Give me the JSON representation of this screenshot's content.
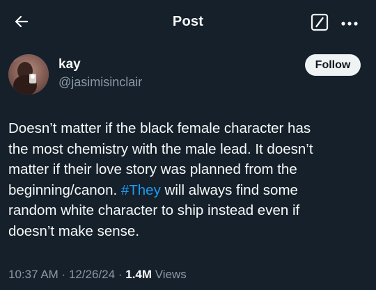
{
  "header": {
    "title": "Post",
    "back_icon": "arrow-left-icon",
    "grok_icon": "slash-box-icon",
    "more_icon": "more-horizontal-icon"
  },
  "author": {
    "name": "kay",
    "handle": "@jasimisinclair",
    "follow_label": "Follow"
  },
  "post": {
    "text_before": "Doesn’t matter if the black female character has\nthe most chemistry with the male lead. It doesn’t\nmatter if their love story was planned from the\nbeginning/canon. ",
    "hashtag": "#They",
    "text_after": " will always find some\nrandom white character to ship instead even if\ndoesn’t make sense."
  },
  "meta": {
    "time": "10:37 AM",
    "separator": " · ",
    "date": "12/26/24",
    "views_count": "1.4M",
    "views_label": " Views"
  },
  "colors": {
    "background": "#15202b",
    "text": "#f7f9f9",
    "secondary_text": "#8b98a5",
    "link": "#1d9bf0",
    "follow_bg": "#eff3f4"
  }
}
